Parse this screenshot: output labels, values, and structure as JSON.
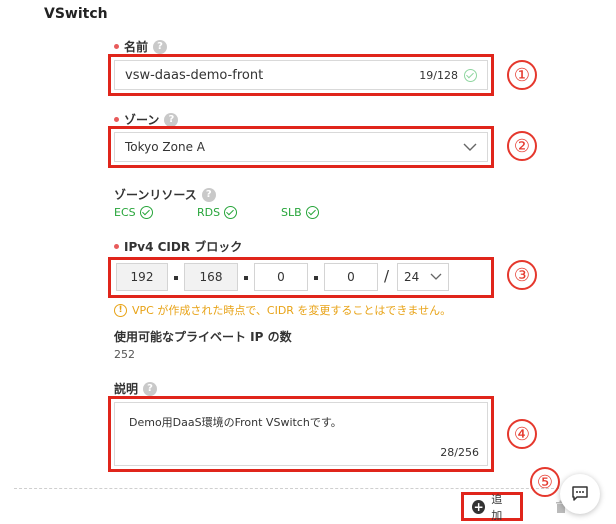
{
  "section": {
    "title": "VSwitch"
  },
  "name_field": {
    "label": "名前",
    "help": "?",
    "value": "vsw-daas-demo-front",
    "counter": "19/128",
    "marker": "①"
  },
  "zone_field": {
    "label": "ゾーン",
    "help": "?",
    "selected": "Tokyo Zone A",
    "marker": "②"
  },
  "zone_resources": {
    "label": "ゾーンリソース",
    "help": "?",
    "items": [
      "ECS",
      "RDS",
      "SLB"
    ]
  },
  "cidr_field": {
    "label": "IPv4 CIDR ブロック",
    "octets": [
      "192",
      "168",
      "0",
      "0"
    ],
    "slash": "/",
    "mask": "24",
    "marker": "③",
    "warning": "VPC が作成された時点で、CIDR を変更することはできません。",
    "warning_icon": "!"
  },
  "private_ip": {
    "label": "使用可能なプライベート IP の数",
    "value": "252"
  },
  "description_field": {
    "label": "説明",
    "help": "?",
    "value": "Demo用DaaS環境のFront VSwitchです。",
    "counter": "28/256",
    "marker": "④"
  },
  "actions": {
    "add_label": "追加",
    "marker": "⑤"
  },
  "colors": {
    "highlight": "#e0251b",
    "success": "#27a53a",
    "warning": "#e8a317",
    "required": "#e85b5b"
  }
}
